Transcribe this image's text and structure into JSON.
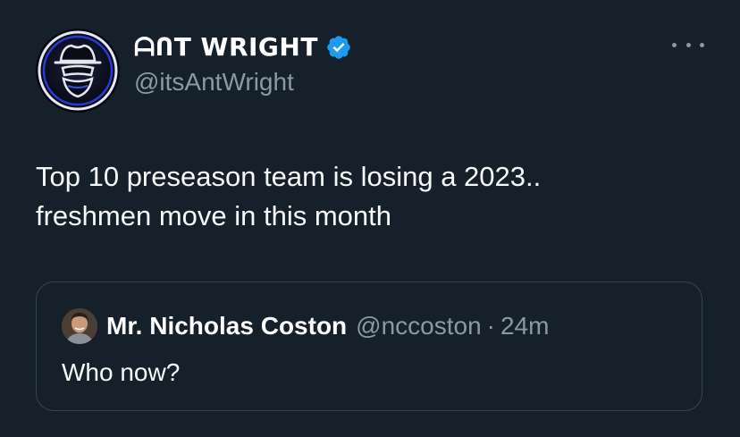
{
  "author": {
    "display_name": "ᗩՈT WRIGHT",
    "handle": "@itsAntWright",
    "verified": true
  },
  "tweet": {
    "lines": [
      "Top 10 preseason team is losing a 2023..",
      "freshmen move in this month"
    ]
  },
  "quoted_tweet": {
    "display_name": "Mr. Nicholas Coston",
    "handle": "@nccoston",
    "separator": "·",
    "time": "24m",
    "text": "Who now?"
  },
  "icons": {
    "verified": "verified-badge-icon",
    "more": "more-options-icon"
  },
  "colors": {
    "background": "#16202b",
    "secondary_text": "#8b98a5",
    "verified_blue": "#1d9bf0",
    "border": "#38444d"
  }
}
